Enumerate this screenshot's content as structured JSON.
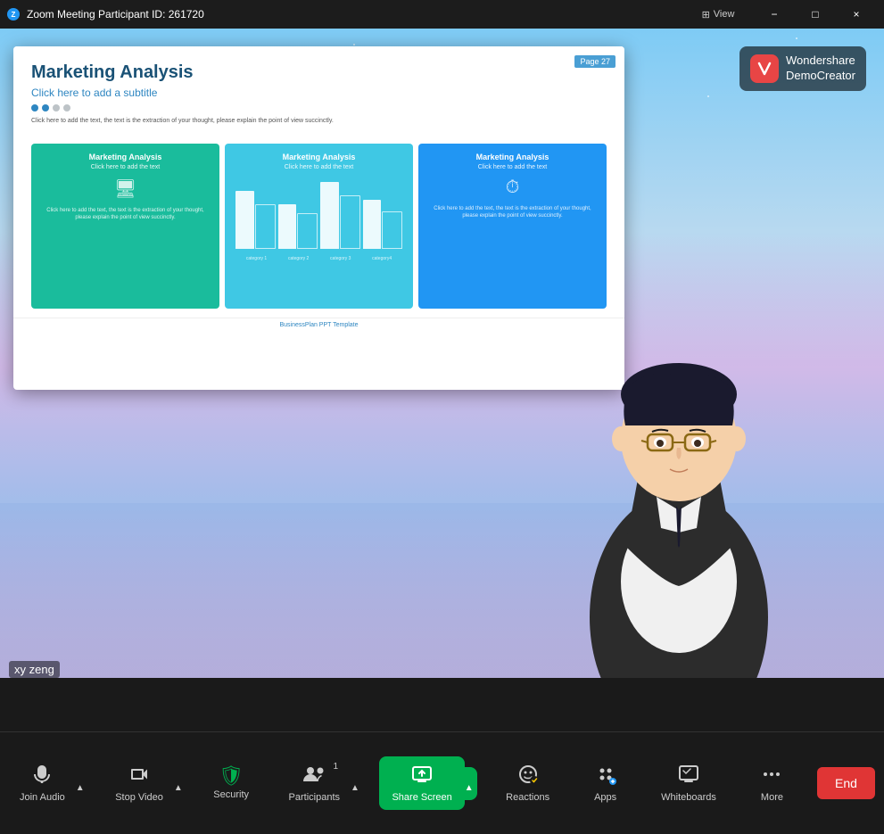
{
  "window": {
    "title": "Zoom Meeting Participant ID: 261720",
    "controls": {
      "minimize": "−",
      "maximize": "□",
      "close": "×"
    }
  },
  "header": {
    "zoom_logo": "Z",
    "view_label": "View",
    "view_icon": "⊞"
  },
  "wondershare": {
    "icon": "W",
    "line1": "Wondershare",
    "line2": "DemoCreator"
  },
  "slide": {
    "page_badge": "Page  27",
    "title": "Marketing Analysis",
    "subtitle": "Click here to add a subtitle",
    "description": "Click here to add the text, the text is the extraction of your thought, please explain the point of view succinctly.",
    "card1": {
      "title": "Marketing Analysis",
      "subtitle": "Click here to add the text",
      "icon": "🖥",
      "text": "Click here to add the text, the text is the extraction of your thought, please explain the point of view succinctly."
    },
    "card2": {
      "title": "Marketing Analysis",
      "subtitle": "Click here to add the text",
      "categories": [
        "category 1",
        "category 2",
        "category 3",
        "category4"
      ]
    },
    "card3": {
      "title": "Marketing Analysis",
      "subtitle": "Click here to add the text",
      "icon": "⏱",
      "text": "Click here to add the text, the text is the extraction of your thought, please explain the point of view succinctly."
    },
    "footer": "BusinessPlan PPT Template"
  },
  "participant": {
    "name": "xy zeng"
  },
  "toolbar": {
    "join_audio_label": "Join Audio",
    "stop_video_label": "Stop Video",
    "security_label": "Security",
    "participants_label": "Participants",
    "participants_count": "1",
    "share_screen_label": "Share Screen",
    "reactions_label": "Reactions",
    "apps_label": "Apps",
    "whiteboards_label": "Whiteboards",
    "more_label": "More",
    "end_label": "End"
  },
  "colors": {
    "toolbar_bg": "#1a1a1a",
    "share_screen_green": "#00b050",
    "end_red": "#e03535",
    "security_green": "#00b050"
  }
}
